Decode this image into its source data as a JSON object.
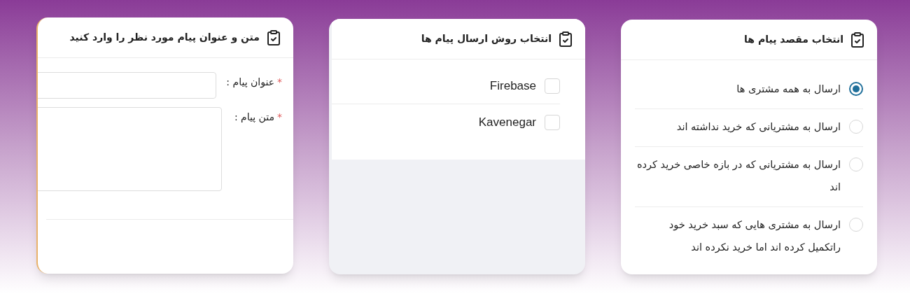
{
  "cards": [
    {
      "kind": "radios",
      "title": "انتخاب مقصد پیام ها",
      "options": [
        {
          "label": "ارسال به همه مشتری ها",
          "selected": true
        },
        {
          "label": "ارسال به مشتریانی که خرید نداشته اند",
          "selected": false
        },
        {
          "label": "ارسال به مشتریانی که در بازه خاصی خرید کرده اند",
          "selected": false
        },
        {
          "label": "ارسال به مشتری هایی که سبد خرید خود راتکمیل کرده اند اما خرید نکرده اند",
          "selected": false
        }
      ]
    },
    {
      "kind": "checkboxes",
      "title": "انتخاب روش ارسال پیام ها",
      "options": [
        {
          "label": "Firebase",
          "checked": false
        },
        {
          "label": "Kavenegar",
          "checked": false
        }
      ]
    },
    {
      "kind": "form",
      "title": "متن و عنوان پیام مورد نظر را وارد کنید",
      "fields": [
        {
          "kind": "input",
          "label": "عنوان پیام :",
          "required_mark": "*"
        },
        {
          "kind": "textarea",
          "label": "متن پیام :",
          "required_mark": "*"
        }
      ]
    }
  ]
}
